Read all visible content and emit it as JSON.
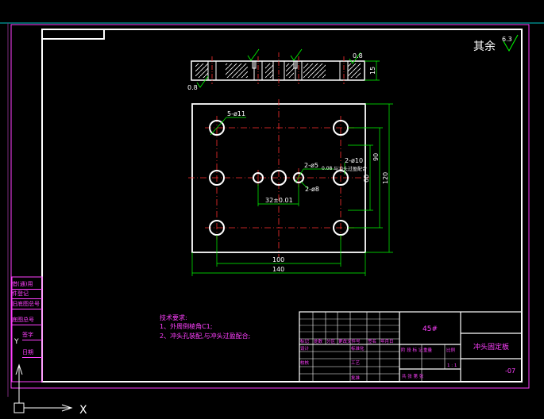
{
  "colors": {
    "background": "#000000",
    "frame": "#ffffff",
    "border_magenta": "#ff40ff",
    "center_line": "#ff3030",
    "dimension": "#00ff00",
    "hatch": "#ffffff",
    "top_line": "#00c8c8"
  },
  "roughness": {
    "label": "其余",
    "value": "6.3"
  },
  "side_view": {
    "roughness_left": "0.8",
    "roughness_right": "0.8",
    "height_dim": "15"
  },
  "plan_view": {
    "holes_5": "5-ø11",
    "holes_2a": "2-ø5",
    "holes_2a_tol": "0.08",
    "holes_2b": "2-ø8",
    "holes_2c": "2-ø10",
    "holes_2c_note": "与冲头过盈配合",
    "spacing_dim": "32±0.01",
    "dim_90": "90",
    "dim_60": "60",
    "dim_120": "120",
    "dim_100": "100",
    "dim_140": "140"
  },
  "tech_notes": {
    "title": "技术要求:",
    "line1": "1、外周倒棱角C1;",
    "line2": "2、冲头孔装配,与冲头过盈配合;"
  },
  "side_table": [
    "借(通)用",
    "件登记",
    "旧底图总号",
    "底图总号",
    "签字",
    "日期"
  ],
  "title_block": {
    "material": "45#",
    "part_name": "冲头固定板",
    "drawing_no": "-07",
    "row_mark": "标记",
    "row_count": "处数",
    "row_zone": "分区",
    "row_change": "更改文件号",
    "row_sign": "签名",
    "row_date": "年月日",
    "design": "设计",
    "standard": "标准化",
    "check": "校核",
    "process": "工艺",
    "approve": "批准",
    "stage": "阶 段 标 记",
    "weight": "重量",
    "scale": "比例",
    "scale_val": "1 : 1",
    "sheet": "共 张   第 张"
  },
  "axis": {
    "x_label": "X",
    "y_label": "Y"
  }
}
